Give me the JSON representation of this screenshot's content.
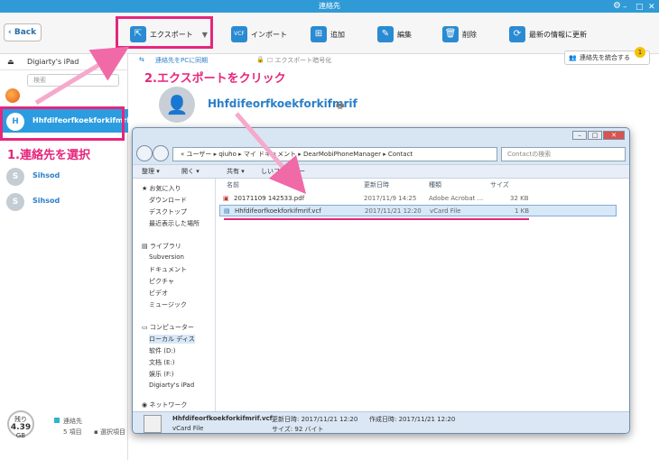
{
  "window": {
    "title": "連絡先"
  },
  "toolbar": {
    "back_label": "Back",
    "export_label": "エクスポート",
    "import_label": "インポート",
    "add_label": "追加",
    "edit_label": "編集",
    "delete_label": "削除",
    "refresh_label": "最新の情報に更新"
  },
  "sidebar": {
    "device_name": "Digiarty's iPad",
    "search_placeholder": "検索",
    "contacts": [
      {
        "initial": "H",
        "name": "Hhfdifeorfkoekforkifmrif"
      },
      {
        "initial": "S",
        "name": "Sihsod"
      },
      {
        "initial": "S",
        "name": "Sihsod"
      }
    ],
    "storage_label": "残り",
    "storage_value": "4.39",
    "storage_unit": "GB",
    "legend_contacts": "連絡先",
    "legend_count": "5 項目",
    "legend_selected": "選択項目"
  },
  "main": {
    "sync_label": "連絡先をPCに同期",
    "encrypt_label": "エクスポート暗号化",
    "merge_label": "連絡先を統合する",
    "merge_badge": "1",
    "contact_title": "Hhfdifeorfkoekforkifmrif"
  },
  "annotations": {
    "step1": "1.連絡先を選択",
    "step2": "2.エクスポートをクリック"
  },
  "explorer": {
    "address": "« ユーザー ▸ qiuho ▸ マイ ドキュメント ▸ DearMobiPhoneManager ▸ Contact",
    "search_placeholder": "Contactの検索",
    "cmd_organize": "整理 ▾",
    "cmd_open": "開く ▾",
    "cmd_share": "共有 ▾",
    "cmd_newfolder": "しいフォルダー",
    "nav": {
      "favorites": "お気に入り",
      "downloads": "ダウンロード",
      "desktop": "デスクトップ",
      "recent": "最近表示した場所",
      "libraries": "ライブラリ",
      "subversion": "Subversion",
      "documents": "ドキュメント",
      "pictures": "ピクチャ",
      "videos": "ビデオ",
      "music": "ミュージック",
      "computer": "コンピューター",
      "local_disk": "ローカル ディス",
      "soft_d": "软件 (D:)",
      "doc_e": "文档 (E:)",
      "ent_f": "娱乐 (F:)",
      "ipad": "Digiarty's iPad",
      "network": "ネットワーク"
    },
    "columns": {
      "name": "名前",
      "date": "更新日時",
      "type": "種類",
      "size": "サイズ"
    },
    "files": [
      {
        "name": "20171109 142533.pdf",
        "date": "2017/11/9 14:25",
        "type": "Adobe Acrobat ...",
        "size": "32 KB"
      },
      {
        "name": "Hhfdifeorfkoekforkifmrif.vcf",
        "date": "2017/11/21 12:20",
        "type": "vCard File",
        "size": "1 KB"
      }
    ],
    "details": {
      "filename": "Hhfdifeorfkoekforkifmrif.vcf",
      "modified": "更新日時: 2017/11/21 12:20",
      "created": "作成日時: 2017/11/21 12:20",
      "filetype": "vCard File",
      "size": "サイズ: 92 バイト"
    }
  }
}
